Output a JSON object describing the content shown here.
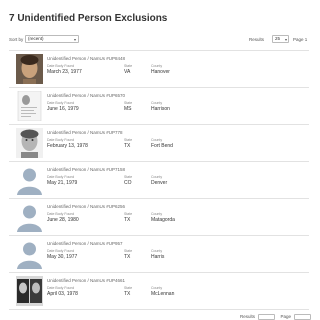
{
  "page": {
    "title": "7 Unidentified Person Exclusions"
  },
  "controls": {
    "sort_label": "Sort by",
    "sort_value": "(recent)",
    "results_label": "Results",
    "results_value": "25",
    "page_label": "Page 1"
  },
  "labels": {
    "date_found": "Date Body Found",
    "state": "State",
    "county": "County"
  },
  "records": [
    {
      "name": "Unidentified Person / NamUs #UP8448",
      "date": "March 23, 1977",
      "state": "VA",
      "county": "Hanover",
      "photo": "photo"
    },
    {
      "name": "Unidentified Person / NamUs #UP6570",
      "date": "June 16, 1979",
      "state": "MS",
      "county": "Harrison",
      "photo": "document"
    },
    {
      "name": "Unidentified Person / NamUs #UP778",
      "date": "February 13, 1978",
      "state": "TX",
      "county": "Fort Bend",
      "photo": "sketch"
    },
    {
      "name": "Unidentified Person / NamUs #UP7158",
      "date": "May 21, 1979",
      "state": "CO",
      "county": "Denver",
      "photo": "placeholder"
    },
    {
      "name": "Unidentified Person / NamUs #UP6256",
      "date": "June 28, 1980",
      "state": "TX",
      "county": "Matagorda",
      "photo": "placeholder"
    },
    {
      "name": "Unidentified Person / NamUs #UP957",
      "date": "May 30, 1977",
      "state": "TX",
      "county": "Harris",
      "photo": "placeholder"
    },
    {
      "name": "Unidentified Person / NamUs #UP4661",
      "date": "April 03, 1978",
      "state": "TX",
      "county": "McLennan",
      "photo": "multi"
    }
  ],
  "pager": {
    "results_label": "Results",
    "page_label": "Page"
  }
}
